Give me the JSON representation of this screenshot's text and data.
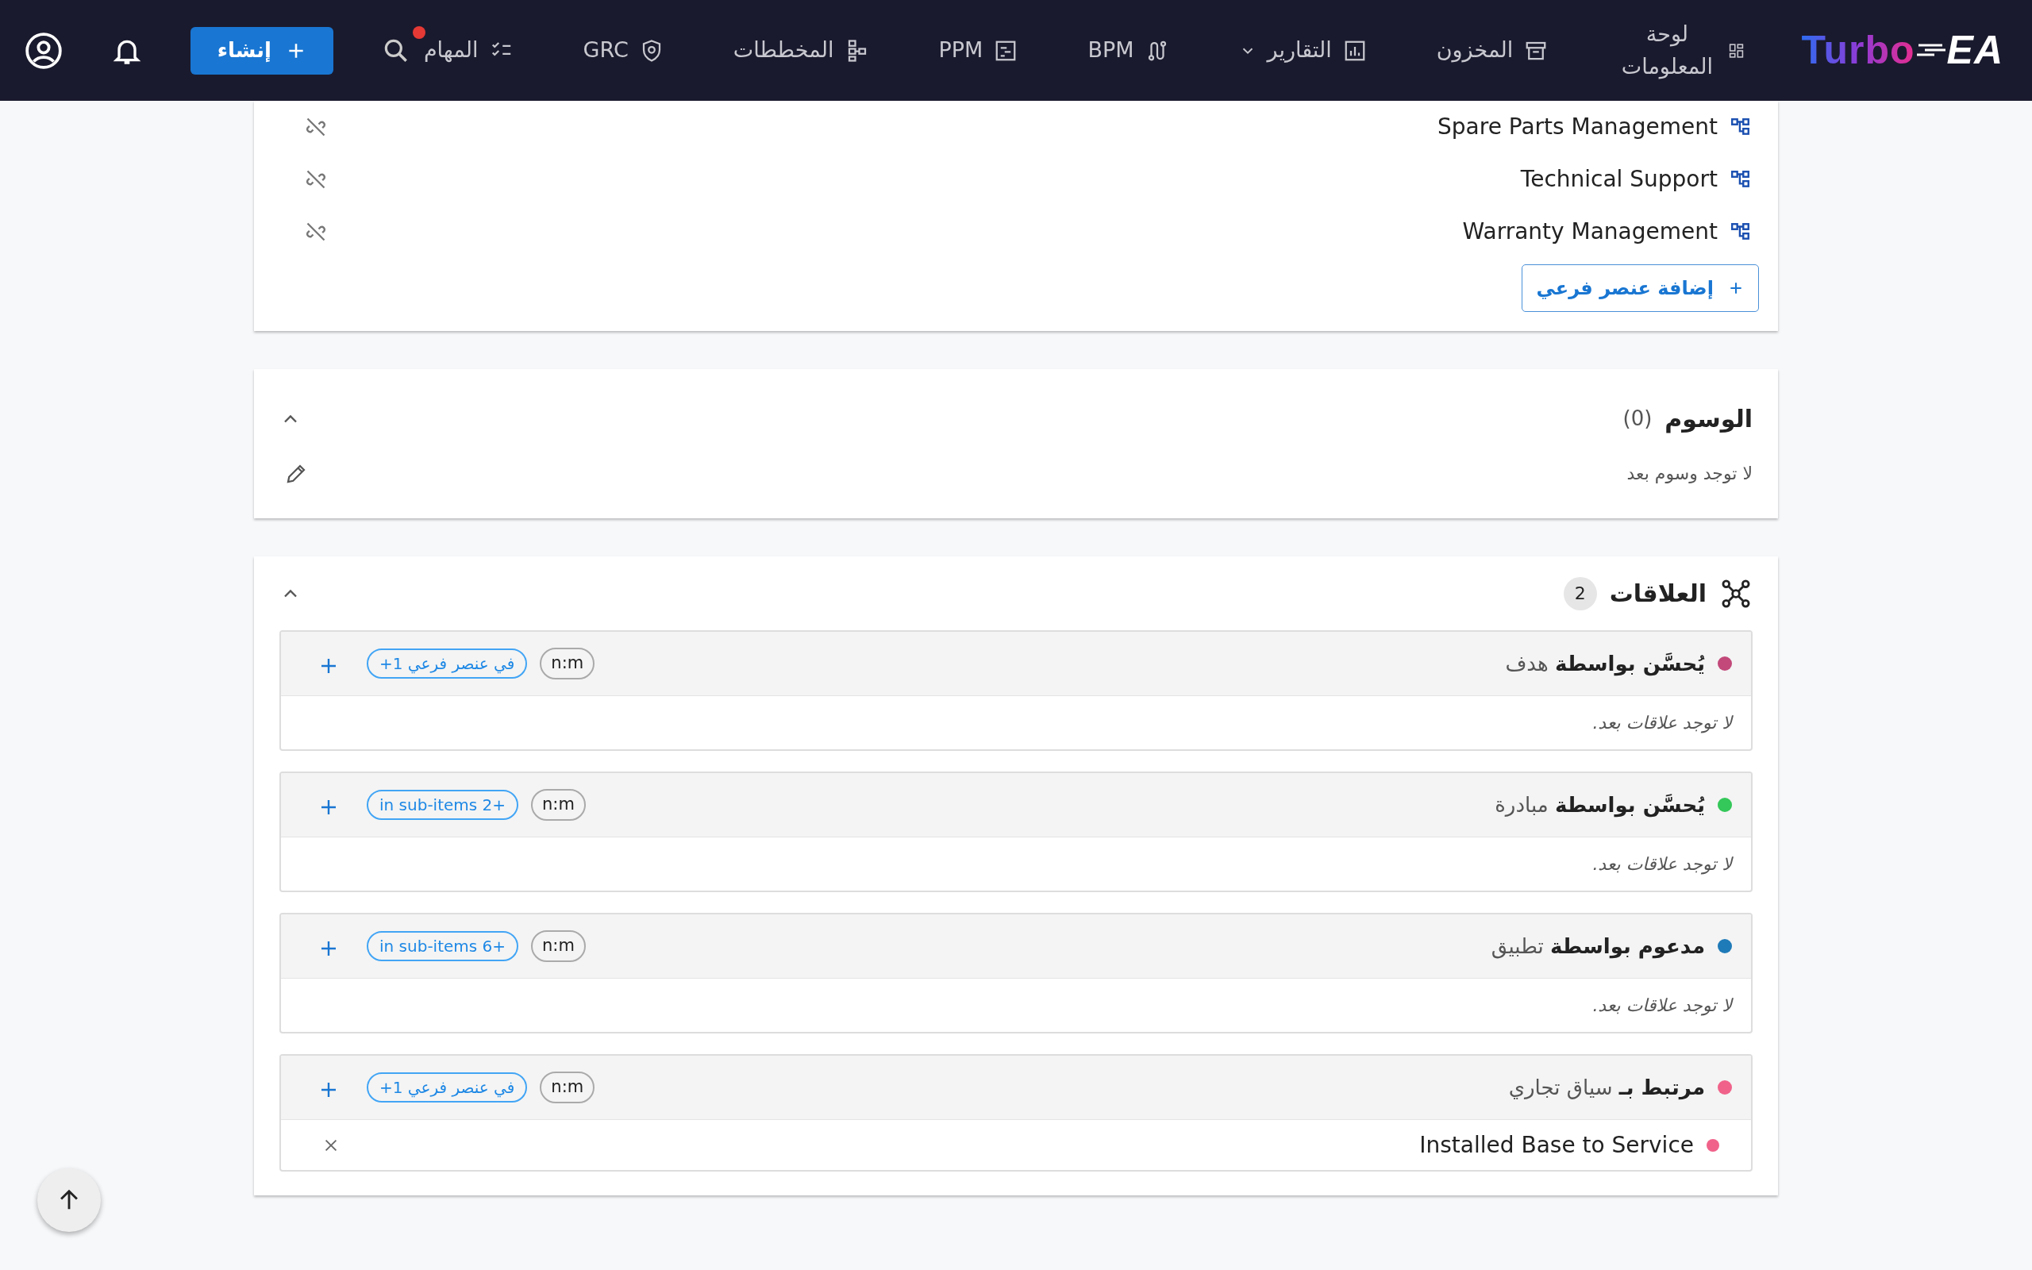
{
  "navbar": {
    "logo_left": "Turbo",
    "logo_right": "EA",
    "items": [
      {
        "label": "لوحة المعلومات",
        "dropdown": false,
        "badge": false
      },
      {
        "label": "المخزون",
        "dropdown": false,
        "badge": false
      },
      {
        "label": "التقارير",
        "dropdown": true,
        "badge": false
      },
      {
        "label": "BPM",
        "dropdown": false,
        "badge": false
      },
      {
        "label": "PPM",
        "dropdown": false,
        "badge": false
      },
      {
        "label": "المخططات",
        "dropdown": false,
        "badge": false
      },
      {
        "label": "GRC",
        "dropdown": false,
        "badge": false
      },
      {
        "label": "المهام",
        "dropdown": false,
        "badge": true
      }
    ],
    "create_button": "إنشاء"
  },
  "children": {
    "items": [
      "Spare Parts Management",
      "Technical Support",
      "Warranty Management"
    ],
    "add_button": "إضافة عنصر فرعي"
  },
  "tags": {
    "title": "الوسوم",
    "count": "(0)",
    "empty": "لا توجد وسوم بعد",
    "expanded": true
  },
  "relations": {
    "title": "العلاقات",
    "count": "2",
    "expanded": true,
    "groups": [
      {
        "title": "**يُحسَّن بواسطة** هدف",
        "color": "#c2497a",
        "cardinality": "n:m",
        "subitems": "+1 في عنصر فرعي",
        "empty": "لا توجد علاقات بعد."
      },
      {
        "title": "**يُحسَّن بواسطة** مبادرة",
        "color": "#34c759",
        "cardinality": "n:m",
        "subitems": "in sub-items 2+",
        "empty": "لا توجد علاقات بعد."
      },
      {
        "title": "**مدعوم بواسطة** تطبيق",
        "color": "#1f7ab8",
        "cardinality": "n:m",
        "subitems": "in sub-items 6+",
        "empty": "لا توجد علاقات بعد."
      },
      {
        "title": "**مرتبط بـ** سياق تجاري",
        "color": "#f0628a",
        "cardinality": "n:m",
        "subitems": "+1 في عنصر فرعي",
        "items": [
          {
            "name": "Installed Base to Service",
            "color": "#f0628a"
          }
        ]
      }
    ]
  }
}
